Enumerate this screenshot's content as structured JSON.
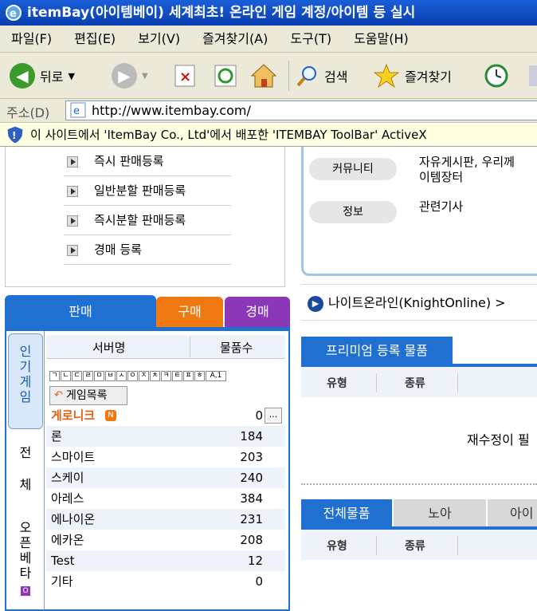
{
  "window": {
    "title": "itemBay(아이템베이) 세계최초! 온라인 게임 계정/아이템 등 실시"
  },
  "menu": [
    "파일(F)",
    "편집(E)",
    "보기(V)",
    "즐겨찾기(A)",
    "도구(T)",
    "도움말(H)"
  ],
  "toolbar": {
    "back": "뒤로",
    "search": "검색",
    "favorites": "즐겨찾기"
  },
  "address": {
    "label": "주소(D)",
    "url": "http://www.itembay.com/"
  },
  "infobar": {
    "text": "이 사이트에서 'ItemBay Co., Ltd'에서 배포한 'ITEMBAY ToolBar' ActiveX"
  },
  "reg_links": [
    "즉시 판매등록",
    "일반분할 판매등록",
    "즉시분할 판매등록",
    "경매 등록"
  ],
  "trade_tabs": {
    "sell": "판매",
    "buy": "구매",
    "auction": "경매"
  },
  "side_tabs": {
    "popular": "인기게임",
    "all_1": "전",
    "all_2": "체",
    "openbeta": "오픈베타",
    "openbeta_badge": "O"
  },
  "game_table": {
    "col_server": "서버명",
    "col_count": "물품수",
    "consonants": [
      "ㄱ",
      "ㄴ",
      "ㄷ",
      "ㄹ",
      "ㅁ",
      "ㅂ",
      "ㅅ",
      "ㅇ",
      "ㅈ",
      "ㅊ",
      "ㅋ",
      "ㅌ",
      "ㅍ",
      "ㅎ",
      "A,1"
    ],
    "game_list_btn": "게임목록",
    "featured": {
      "name": "게로니크",
      "badge": "N",
      "count": "0",
      "more": "..."
    },
    "rows": [
      {
        "name": "론",
        "count": "184"
      },
      {
        "name": "스마이트",
        "count": "203"
      },
      {
        "name": "스케이",
        "count": "240"
      },
      {
        "name": "아레스",
        "count": "384"
      },
      {
        "name": "에나이온",
        "count": "231"
      },
      {
        "name": "에카온",
        "count": "208"
      },
      {
        "name": "Test",
        "count": "12"
      },
      {
        "name": "기타",
        "count": "0"
      }
    ]
  },
  "info_box": {
    "community_label": "커뮤니티",
    "community_text_1": "자유게시판, 우리께",
    "community_text_2": "이템장터",
    "info_label": "정보",
    "info_text": "관련기사"
  },
  "breadcrumb": "나이트온라인(KnightOnline) >",
  "premium": {
    "title": "프리미엄 등록 물품",
    "col_type": "유형",
    "col_kind": "종류",
    "message": "재수정이 필"
  },
  "bottom_tabs": {
    "all": "전체물품",
    "noa": "노아",
    "aio": "아이"
  },
  "bottom_cols": {
    "col_type": "유형",
    "col_kind": "종류"
  }
}
